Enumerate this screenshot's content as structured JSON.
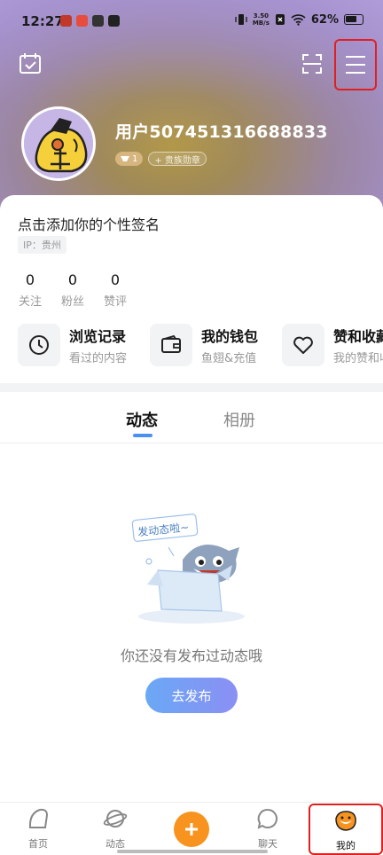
{
  "status_bar": {
    "time": "12:27",
    "net_speed_value": "3.50",
    "net_speed_unit": "MB/s",
    "battery": "62%"
  },
  "profile": {
    "username": "用户507451316688833",
    "level": "1",
    "noble_badge": "+ 贵族勋章",
    "signature": "点击添加你的个性签名",
    "ip_location": "IP：贵州"
  },
  "stats": [
    {
      "value": "0",
      "label": "关注"
    },
    {
      "value": "0",
      "label": "粉丝"
    },
    {
      "value": "0",
      "label": "赞评"
    }
  ],
  "shortcuts": [
    {
      "title": "浏览记录",
      "subtitle": "看过的内容",
      "icon": "clock-icon"
    },
    {
      "title": "我的钱包",
      "subtitle": "鱼翅&充值",
      "icon": "wallet-icon"
    },
    {
      "title": "赞和收藏",
      "subtitle": "我的赞和收",
      "icon": "heart-icon"
    }
  ],
  "tabs": [
    {
      "label": "动态",
      "active": true
    },
    {
      "label": "相册",
      "active": false
    }
  ],
  "empty_state": {
    "bubble_text": "发动态啦~",
    "message": "你还没有发布过动态哦",
    "button_label": "去发布"
  },
  "bottom_nav": [
    {
      "label": "首页",
      "icon": "home-icon"
    },
    {
      "label": "动态",
      "icon": "planet-icon"
    },
    {
      "label": "",
      "icon": "plus-icon"
    },
    {
      "label": "聊天",
      "icon": "chat-icon"
    },
    {
      "label": "我的",
      "icon": "shark-mascot-icon",
      "active": true
    }
  ],
  "colors": {
    "accent_blue": "#4a90f0",
    "publish_orange": "#f7931e",
    "highlight_red": "#e02020"
  }
}
